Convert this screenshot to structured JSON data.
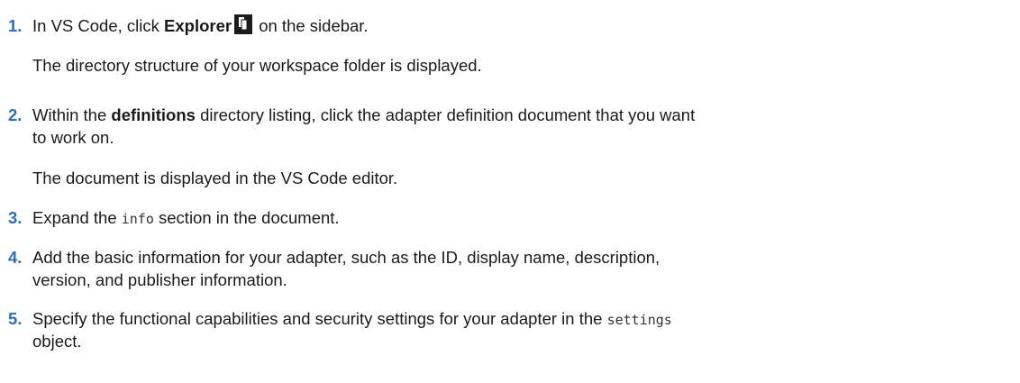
{
  "steps": [
    {
      "number": "1.",
      "text_before": "In VS Code, click ",
      "bold": "Explorer",
      "icon": "explorer-icon",
      "text_after": " on the sidebar.",
      "result": "The directory structure of your workspace folder is displayed."
    },
    {
      "number": "2.",
      "text_before": "Within the ",
      "bold": "definitions",
      "text_after_line1": " directory listing, click the adapter definition document that you want",
      "text_line2": "to work on.",
      "result": "The document is displayed in the VS Code editor."
    },
    {
      "number": "3.",
      "text_before": "Expand the ",
      "code": "info",
      "text_after": " section in the document."
    },
    {
      "number": "4.",
      "text_line1": "Add the basic information for your adapter, such as the ID, display name, description,",
      "text_line2": "version, and publisher information."
    },
    {
      "number": "5.",
      "text_line1_before": "Specify the functional capabilities and security settings for your adapter in the ",
      "code": "settings",
      "text_line2": "object."
    }
  ]
}
